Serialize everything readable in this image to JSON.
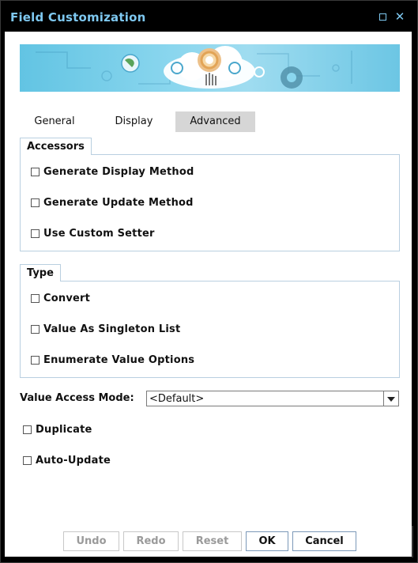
{
  "window": {
    "title": "Field Customization"
  },
  "titlebar": {
    "maximize_icon": "maximize-icon",
    "close_icon": "close-icon",
    "close_glyph": "✕"
  },
  "banner": {
    "icon": "cloud-gears-banner"
  },
  "tabs": [
    {
      "label": "General",
      "active": false
    },
    {
      "label": "Display",
      "active": false
    },
    {
      "label": "Advanced",
      "active": true
    }
  ],
  "accessors": {
    "label": "Accessors",
    "items": [
      {
        "label": "Generate Display Method",
        "checked": false
      },
      {
        "label": "Generate Update Method",
        "checked": false
      },
      {
        "label": "Use Custom Setter",
        "checked": false
      }
    ]
  },
  "type": {
    "label": "Type",
    "items": [
      {
        "label": "Convert",
        "checked": false
      },
      {
        "label": "Value As Singleton List",
        "checked": false
      },
      {
        "label": "Enumerate Value Options",
        "checked": false
      }
    ]
  },
  "value_access_mode": {
    "label": "Value Access Mode:",
    "value": "<Default>"
  },
  "options": [
    {
      "label": "Duplicate",
      "checked": false
    },
    {
      "label": "Auto-Update",
      "checked": false
    }
  ],
  "buttons": {
    "undo": "Undo",
    "redo": "Redo",
    "reset": "Reset",
    "ok": "OK",
    "cancel": "Cancel"
  },
  "colors": {
    "title": "#7ec8f0",
    "banner": "#7fd0ea",
    "group_border": "#b9cfe0",
    "active_tab": "#d6d6d6"
  }
}
